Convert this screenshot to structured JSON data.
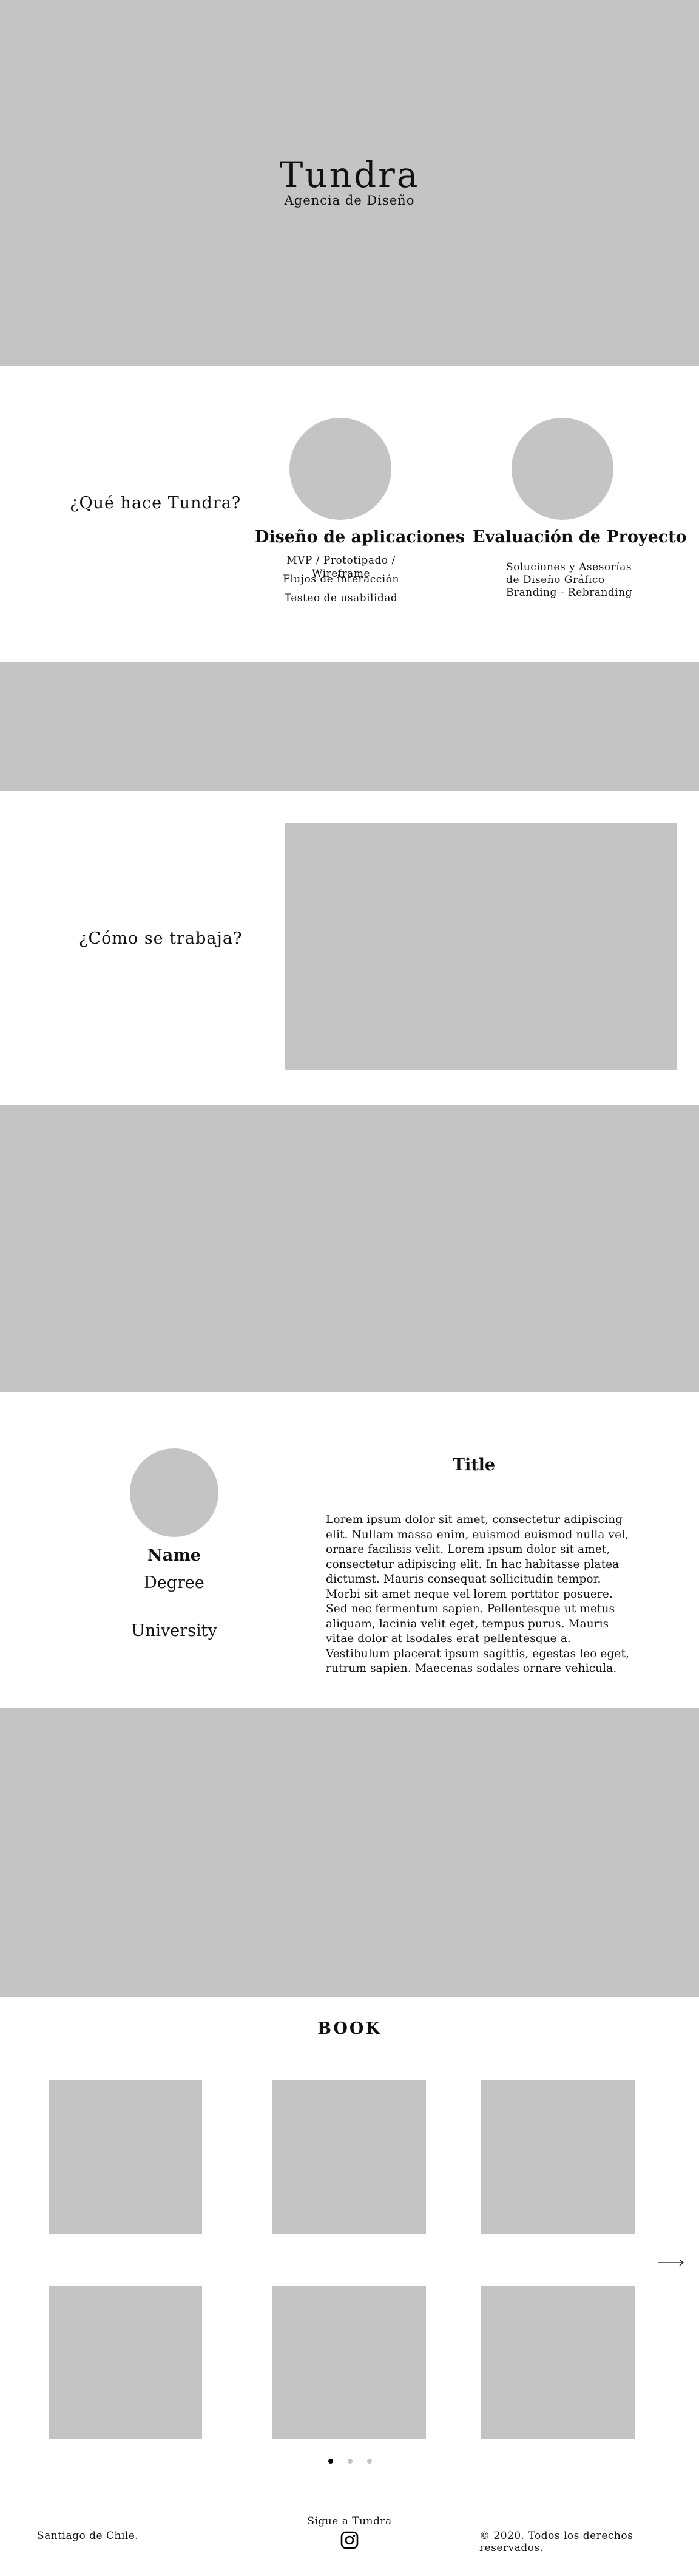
{
  "hero": {
    "title": "Tundra",
    "subtitle": "Agencia de Diseño"
  },
  "services": {
    "heading": "¿Qué hace Tundra?",
    "items": [
      {
        "title": "Diseño de aplicaciones",
        "lines": [
          "MVP / Prototipado / Wireframe",
          "Flujos de interacción",
          "Testeo de usabilidad"
        ]
      },
      {
        "title": "Evaluación de Proyecto",
        "lines": [
          "Soluciones y Asesorías",
          "de Diseño Gráfico",
          "Branding - Rebranding"
        ]
      }
    ]
  },
  "process": {
    "heading": "¿Cómo se trabaja?"
  },
  "team": {
    "name": "Name",
    "degree": "Degree",
    "university": "University",
    "title": "Title",
    "bio": "Lorem ipsum dolor sit amet, consectetur adipiscing elit. Nullam massa enim, euismod euismod nulla vel, ornare facilisis velit. Lorem ipsum dolor sit amet, consectetur adipiscing elit. In hac habitasse platea dictumst. Mauris consequat sollicitudin tempor. Morbi sit amet neque vel lorem porttitor posuere. Sed nec fermentum sapien. Pellentesque ut metus aliquam, lacinia velit eget, tempus purus. Mauris vitae dolor at lsodales erat pellentesque a. Vestibulum placerat ipsum sagittis, egestas leo eget, rutrum sapien. Maecenas sodales ornare vehicula."
  },
  "book": {
    "title": "BOOK",
    "item_count": 6,
    "pagination": {
      "pages": 3,
      "active_index": 0
    },
    "next_icon": "arrow-right-icon"
  },
  "footer": {
    "location": "Santiago de Chile.",
    "follow_label": "Sigue a Tundra",
    "social_icon": "instagram-icon",
    "copyright": "© 2020. Todos los derechos reservados."
  },
  "colors": {
    "placeholder_gray": "#c4c4c4",
    "text": "#111111",
    "background": "#ffffff",
    "active_dot": "#000000"
  }
}
